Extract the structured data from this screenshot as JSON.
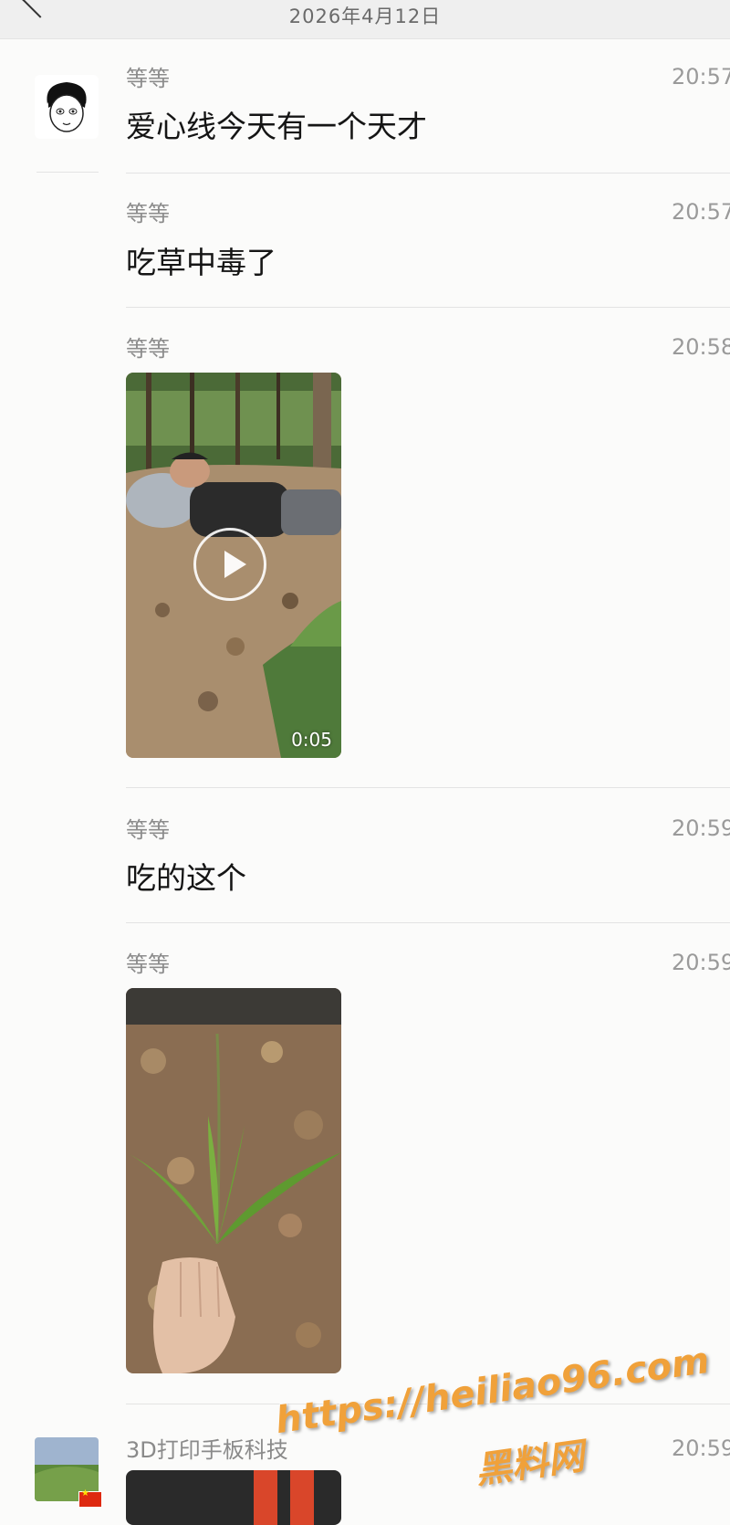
{
  "header": {
    "date": "2026年4月12日"
  },
  "messages": [
    {
      "sender": "等等",
      "time": "20:57",
      "text": "爱心线今天有一个天才"
    },
    {
      "sender": "等等",
      "time": "20:57",
      "text": "吃草中毒了"
    },
    {
      "sender": "等等",
      "time": "20:58",
      "video_duration": "0:05"
    },
    {
      "sender": "等等",
      "time": "20:59",
      "text": "吃的这个"
    },
    {
      "sender": "等等",
      "time": "20:59"
    },
    {
      "sender": "3D打印手板科技",
      "time": "20:59"
    }
  ],
  "watermark": {
    "url": "https://heiliao96.com",
    "name": "黑料网"
  },
  "colors": {
    "background": "#fbfbfa",
    "header_bg": "#efefef",
    "watermark": "#f0a13a"
  }
}
